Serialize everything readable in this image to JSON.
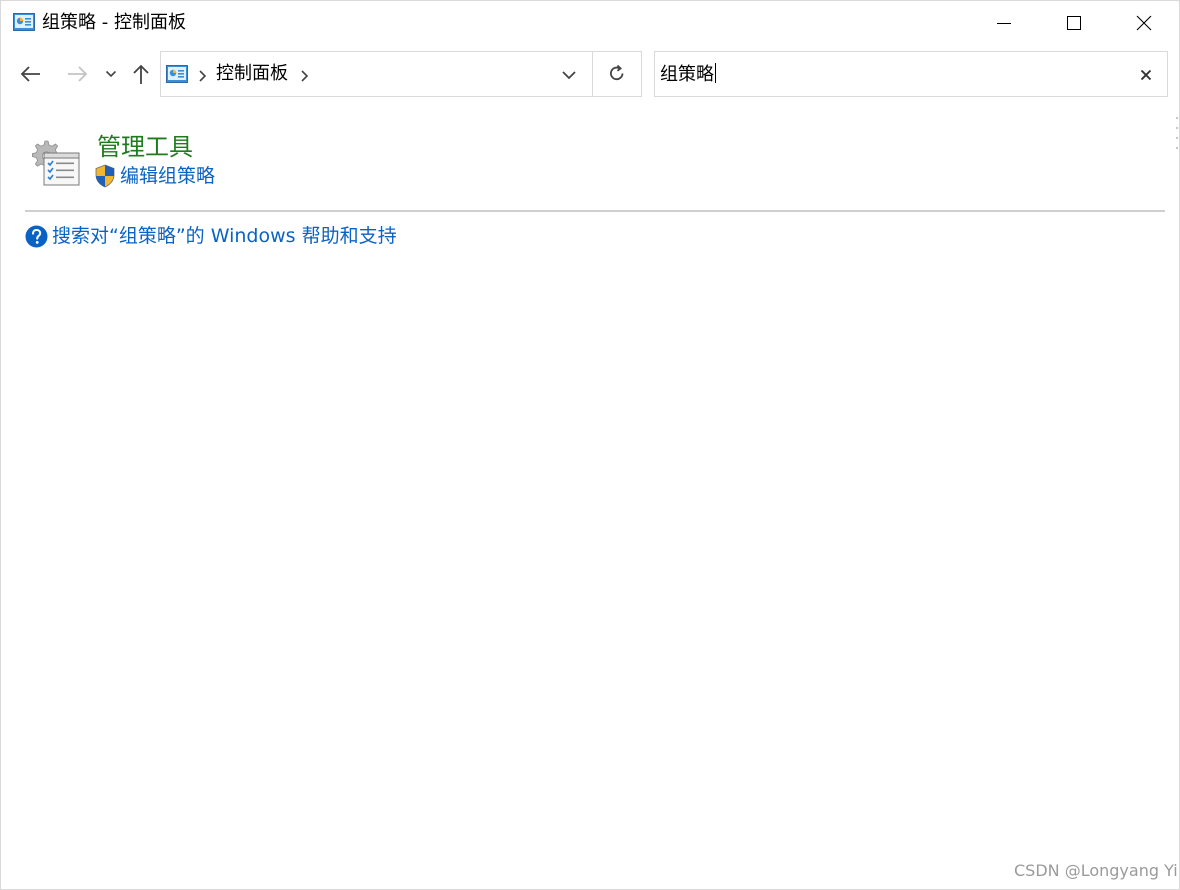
{
  "window": {
    "title": "组策略 - 控制面板"
  },
  "navigation": {
    "breadcrumb": "控制面板",
    "search_value": "组策略"
  },
  "results": {
    "category_title": "管理工具",
    "task_link": "编辑组策略",
    "help_link": "搜索对“组策略”的 Windows 帮助和支持"
  },
  "watermark": "CSDN @Longyang Yi",
  "icons": {
    "title": "control-panel-icon",
    "back": "arrow-left-icon",
    "forward": "arrow-right-icon",
    "recent": "chevron-down-icon",
    "up": "arrow-up-icon",
    "refresh": "refresh-icon",
    "clear": "close-icon",
    "category": "administrative-tools-icon",
    "task": "uac-shield-icon",
    "help": "help-icon"
  },
  "colors": {
    "category_title": "#1e7b1e",
    "link": "#0a63c4",
    "help_icon": "#0a63c4",
    "border": "#d9d9d9"
  }
}
